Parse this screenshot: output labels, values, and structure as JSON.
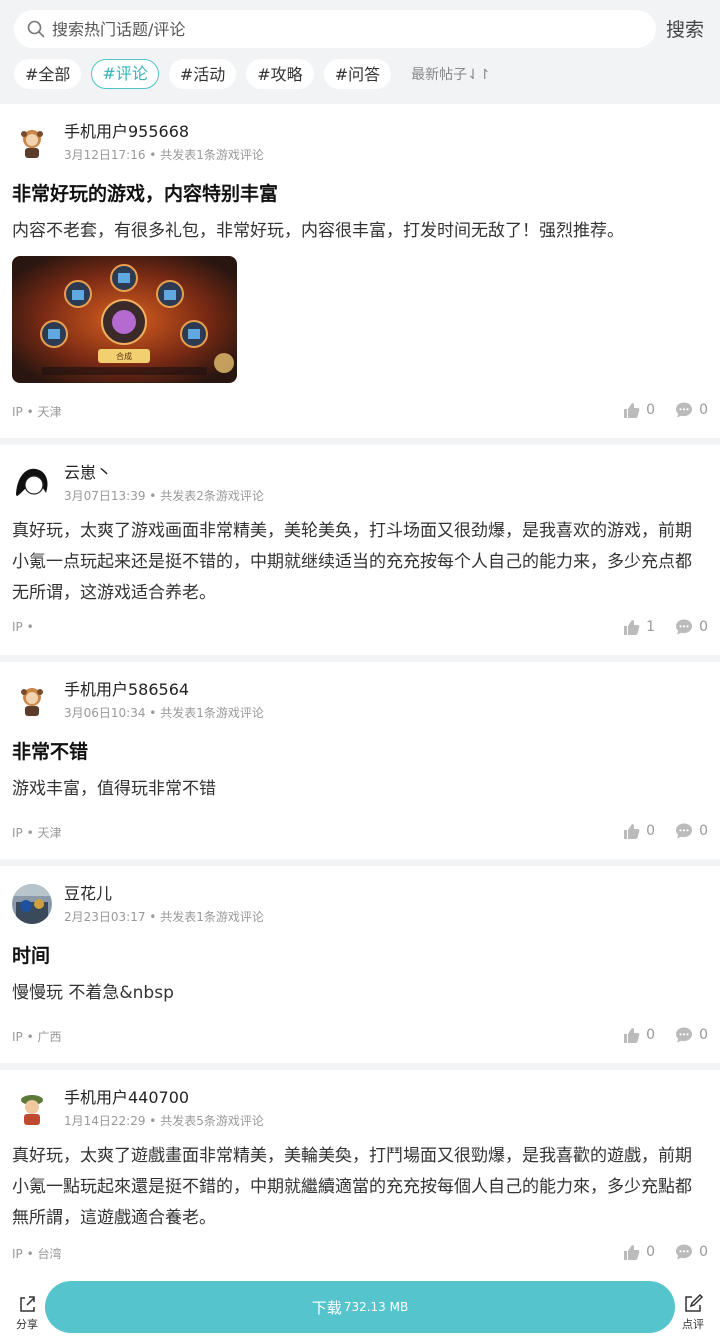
{
  "search": {
    "placeholder": "搜索热门话题/评论",
    "button": "搜索"
  },
  "tags": [
    "#全部",
    "#评论",
    "#活动",
    "#攻略",
    "#问答"
  ],
  "sort_label": "最新帖子⇃↾",
  "posts": [
    {
      "user": "手机用户955668",
      "meta": "3月12日17:16 • 共发表1条游戏评论",
      "title": "非常好玩的游戏，内容特别丰富",
      "body": "内容不老套，有很多礼包，非常好玩，内容很丰富，打发时间无敌了！强烈推荐。",
      "thumb_label": "合成",
      "ip": "IP • 天津",
      "likes": "0",
      "comments": "0"
    },
    {
      "user": "云崽丶",
      "meta": "3月07日13:39 • 共发表2条游戏评论",
      "body": "真好玩，太爽了游戏画面非常精美，美轮美奂，打斗场面又很劲爆，是我喜欢的游戏，前期小氪一点玩起来还是挺不错的，中期就继续适当的充充按每个人自己的能力来，多少充点都无所谓，这游戏适合养老。",
      "ip": "IP •",
      "likes": "1",
      "comments": "0"
    },
    {
      "user": "手机用户586564",
      "meta": "3月06日10:34 • 共发表1条游戏评论",
      "title": "非常不错",
      "body": "游戏丰富，值得玩非常不错",
      "ip": "IP • 天津",
      "likes": "0",
      "comments": "0"
    },
    {
      "user": "豆花儿",
      "meta": "2月23日03:17 • 共发表1条游戏评论",
      "title": "时间",
      "body": "慢慢玩 不着急&nbsp",
      "ip": "IP • 广西",
      "likes": "0",
      "comments": "0"
    },
    {
      "user": "手机用户440700",
      "meta": "1月14日22:29 • 共发表5条游戏评论",
      "body": "真好玩，太爽了遊戲畫面非常精美，美輪美奐，打鬥場面又很勁爆，是我喜歡的遊戲，前期小氪一點玩起來還是挺不錯的，中期就繼續適當的充充按每個人自己的能力來，多少充點都無所謂，這遊戲適合養老。",
      "ip": "IP • 台湾",
      "likes": "0",
      "comments": "0"
    }
  ],
  "bottom": {
    "share": "分享",
    "download": "下载",
    "size": "732.13 MB",
    "rate": "点评"
  },
  "colors": {
    "accent": "#55c4cc",
    "tag_active": "#38b2b9",
    "muted": "#999999"
  },
  "icons": [
    "search-icon",
    "like-icon",
    "comment-icon",
    "share-icon",
    "edit-icon"
  ]
}
